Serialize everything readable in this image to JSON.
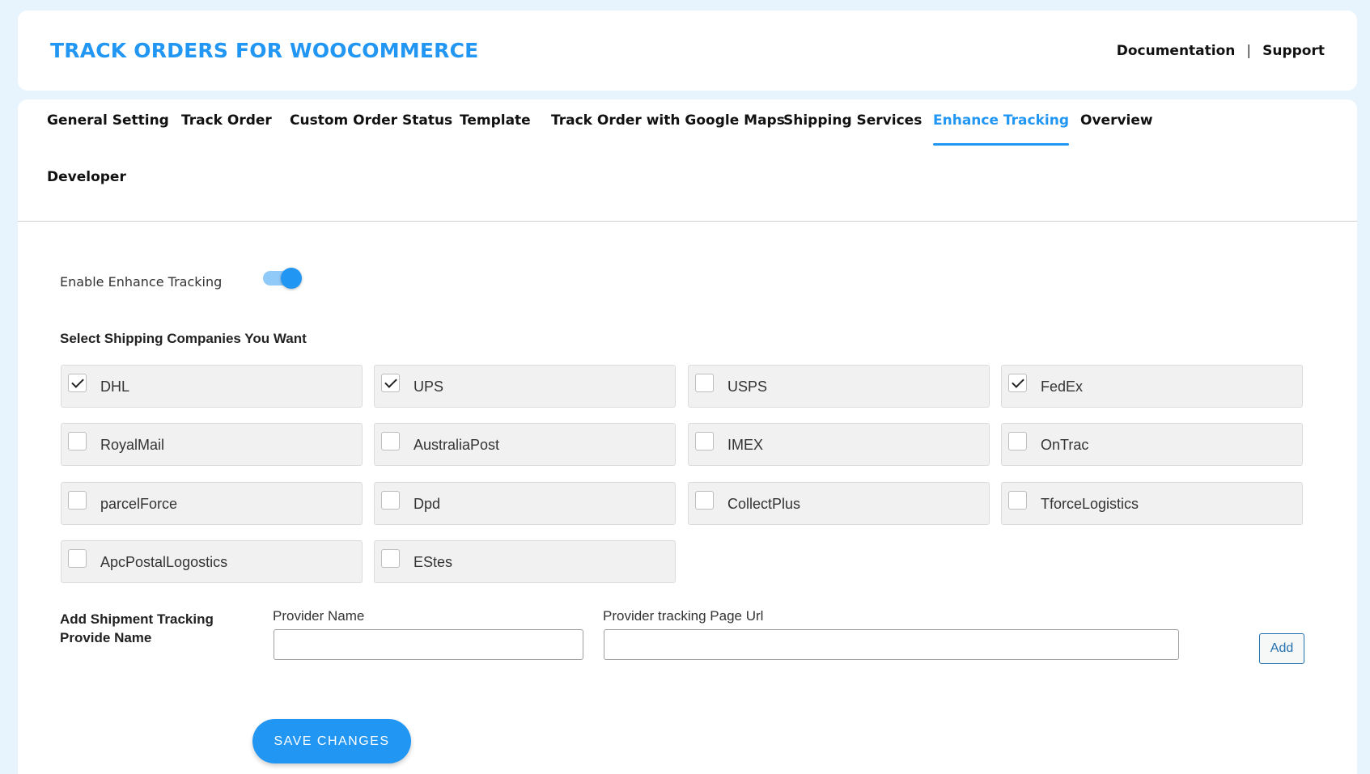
{
  "header": {
    "brand": "TRACK ORDERS FOR WOOCOMMERCE",
    "documentation": "Documentation",
    "separator": "|",
    "support": "Support"
  },
  "tabs": [
    {
      "label": "General Setting",
      "active": false
    },
    {
      "label": "Track Order",
      "active": false
    },
    {
      "label": "Custom Order Status",
      "active": false
    },
    {
      "label": "Template",
      "active": false
    },
    {
      "label": "Track Order with Google Maps",
      "active": false
    },
    {
      "label": "Shipping Services",
      "active": false
    },
    {
      "label": "Enhance Tracking",
      "active": true
    },
    {
      "label": "Overview",
      "active": false
    },
    {
      "label": "Developer",
      "active": false
    }
  ],
  "enhance": {
    "label": "Enable Enhance Tracking",
    "enabled": true
  },
  "companies": {
    "title": "Select Shipping Companies You Want",
    "items": [
      {
        "name": "DHL",
        "checked": true
      },
      {
        "name": "UPS",
        "checked": true
      },
      {
        "name": "USPS",
        "checked": false
      },
      {
        "name": "FedEx",
        "checked": true
      },
      {
        "name": "RoyalMail",
        "checked": false
      },
      {
        "name": "AustraliaPost",
        "checked": false
      },
      {
        "name": "IMEX",
        "checked": false
      },
      {
        "name": "OnTrac",
        "checked": false
      },
      {
        "name": "parcelForce",
        "checked": false
      },
      {
        "name": "Dpd",
        "checked": false
      },
      {
        "name": "CollectPlus",
        "checked": false
      },
      {
        "name": "TforceLogistics",
        "checked": false
      },
      {
        "name": "ApcPostalLogostics",
        "checked": false
      },
      {
        "name": "EStes",
        "checked": false
      }
    ]
  },
  "shipment": {
    "title_line1": "Add Shipment Tracking",
    "title_line2": "Provide Name",
    "provider_name_label": "Provider Name",
    "provider_name_value": "",
    "provider_url_label": "Provider tracking Page Url",
    "provider_url_value": "",
    "add_label": "Add"
  },
  "save_label": "SAVE CHANGES",
  "colors": {
    "accent": "#2196f3",
    "background": "#e8f4fd"
  }
}
